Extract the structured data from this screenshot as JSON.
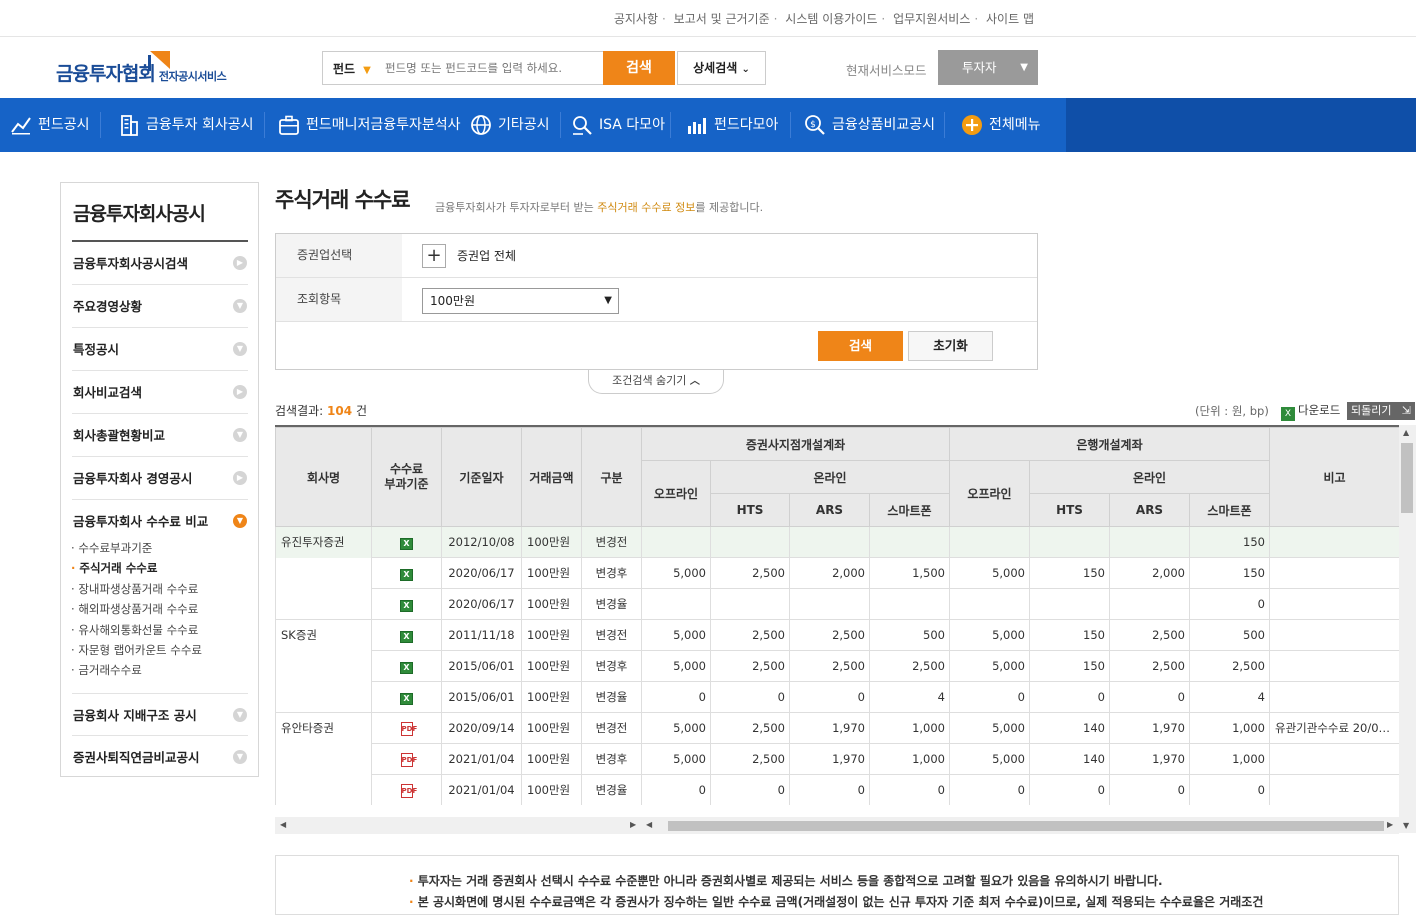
{
  "util_links": [
    "공지사항",
    "보고서 및 근거기준",
    "시스템 이용가이드",
    "업무지원서비스",
    "사이트 맵"
  ],
  "logo": {
    "main": "금융투자협회",
    "sub": "전자공시서비스"
  },
  "search": {
    "category": "펀드",
    "placeholder": "펀드명 또는 펀드코드를 입력 하세요.",
    "button": "검색",
    "advanced": "상세검색"
  },
  "mode": {
    "label": "현재서비스모드",
    "value": "투자자"
  },
  "gnb": [
    "펀드공시",
    "금융투자 회사공시",
    "펀드매니저금융투자분석사",
    "기타공시",
    "ISA 다모아",
    "펀드다모아",
    "금융상품비교공시",
    "전체메뉴"
  ],
  "lnb": {
    "title": "금융투자회사공시",
    "items": [
      "금융투자회사공시검색",
      "주요경영상황",
      "특정공시",
      "회사비교검색",
      "회사총괄현황비교",
      "금융투자회사 경영공시",
      "금융투자회사 수수료 비교",
      "금융회사 지배구조 공시",
      "증권사퇴직연금비교공시"
    ],
    "subitems": [
      "수수료부과기준",
      "주식거래 수수료",
      "장내파생상품거래 수수료",
      "해외파생상품거래 수수료",
      "유사해외통화선물 수수료",
      "자문형 랩어카운트 수수료",
      "금거래수수료"
    ]
  },
  "page": {
    "title": "주식거래 수수료",
    "desc_pre": "금융투자회사가 투자자로부터 받는 ",
    "desc_hl": "주식거래 수수료 정보",
    "desc_post": "를 제공합니다."
  },
  "filter": {
    "row1_label": "증권업선택",
    "row1_plus": "+",
    "row1_value": "증권업 전체",
    "row2_label": "조회항목",
    "row2_value": "100만원",
    "search": "검색",
    "reset": "초기화",
    "toggle": "조건검색 숨기기"
  },
  "result": {
    "label": "검색결과:",
    "count": "104",
    "unit_word": "건"
  },
  "unit_text": "(단위 : 원, bp)",
  "download": "다운로드",
  "back": "되돌리기",
  "table": {
    "headers": {
      "company": "회사명",
      "basis": "수수료\n부과기준",
      "date": "기준일자",
      "amount": "거래금액",
      "type": "구분",
      "group_sec": "증권사지점개설계좌",
      "group_bank": "은행개설계좌",
      "offline": "오프라인",
      "online": "온라인",
      "hts": "HTS",
      "ars": "ARS",
      "smart": "스마트폰",
      "note": "비고"
    },
    "rows": [
      {
        "company": "유진투자증권",
        "doc": "xl",
        "date": "2012/10/08",
        "amount": "100만원",
        "type": "변경전",
        "v": [
          "",
          "",
          "",
          "",
          "",
          "",
          "",
          "150"
        ],
        "note": ""
      },
      {
        "company": "",
        "doc": "xl",
        "date": "2020/06/17",
        "amount": "100만원",
        "type": "변경후",
        "v": [
          "5,000",
          "2,500",
          "2,000",
          "1,500",
          "5,000",
          "150",
          "2,000",
          "150"
        ],
        "note": ""
      },
      {
        "company": "",
        "doc": "xl",
        "date": "2020/06/17",
        "amount": "100만원",
        "type": "변경율",
        "v": [
          "",
          "",
          "",
          "",
          "",
          "",
          "",
          "0"
        ],
        "note": ""
      },
      {
        "company": "SK증권",
        "doc": "xl",
        "date": "2011/11/18",
        "amount": "100만원",
        "type": "변경전",
        "v": [
          "5,000",
          "2,500",
          "2,500",
          "500",
          "5,000",
          "150",
          "2,500",
          "500"
        ],
        "note": ""
      },
      {
        "company": "",
        "doc": "xl",
        "date": "2015/06/01",
        "amount": "100만원",
        "type": "변경후",
        "v": [
          "5,000",
          "2,500",
          "2,500",
          "2,500",
          "5,000",
          "150",
          "2,500",
          "2,500"
        ],
        "note": ""
      },
      {
        "company": "",
        "doc": "xl",
        "date": "2015/06/01",
        "amount": "100만원",
        "type": "변경율",
        "v": [
          "0",
          "0",
          "0",
          "4",
          "0",
          "0",
          "0",
          "4"
        ],
        "note": ""
      },
      {
        "company": "유안타증권",
        "doc": "pdf",
        "date": "2020/09/14",
        "amount": "100만원",
        "type": "변경전",
        "v": [
          "5,000",
          "2,500",
          "1,970",
          "1,000",
          "5,000",
          "140",
          "1,970",
          "1,000"
        ],
        "note": "유관기관수수료 20/0…"
      },
      {
        "company": "",
        "doc": "pdf",
        "date": "2021/01/04",
        "amount": "100만원",
        "type": "변경후",
        "v": [
          "5,000",
          "2,500",
          "1,970",
          "1,000",
          "5,000",
          "140",
          "1,970",
          "1,000"
        ],
        "note": ""
      },
      {
        "company": "",
        "doc": "pdf",
        "date": "2021/01/04",
        "amount": "100만원",
        "type": "변경율",
        "v": [
          "0",
          "0",
          "0",
          "0",
          "0",
          "0",
          "0",
          "0"
        ],
        "note": ""
      }
    ]
  },
  "notice": [
    {
      "bullet": "·",
      "text": "투자자는 거래 증권회사 선택시 수수료 수준뿐만 아니라 증권회사별로 제공되는 서비스 등을 종합적으로 고려할 필요가 있음을 유의하시기 바랍니다."
    },
    {
      "bullet": "·",
      "text": "본 공시화면에 명시된 수수료금액은 각 증권사가 징수하는 일반 수수료 금액(거래설정이 없는 신규 투자자 기준 최저 수수료)이므로, 실제 적용되는 수수료율은 거래조건"
    }
  ],
  "colors": {
    "accent": "#ef8518",
    "nav": "#1663c7",
    "brand": "#1a4c97"
  }
}
